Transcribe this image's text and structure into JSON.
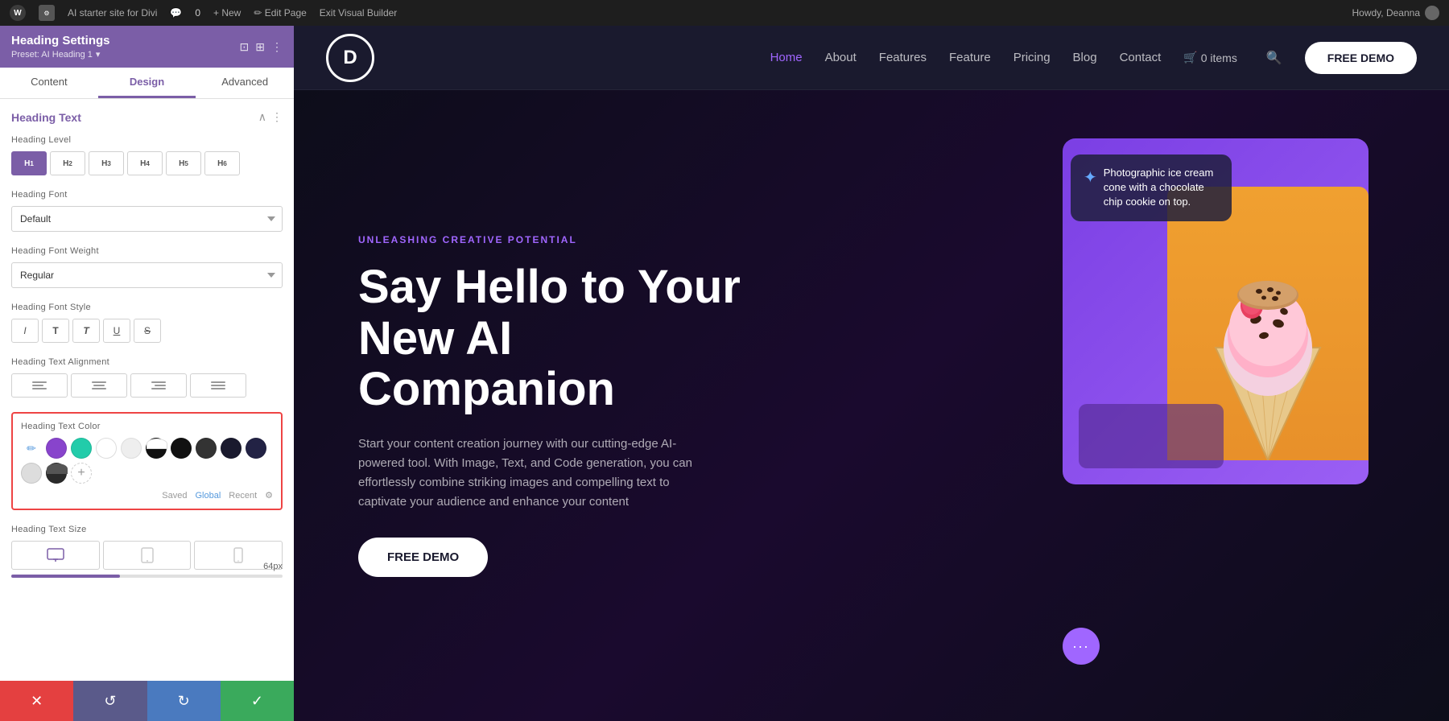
{
  "admin_bar": {
    "site_name": "AI starter site for Divi",
    "comments": "0",
    "new_label": "+ New",
    "edit_page": "✏ Edit Page",
    "exit_builder": "Exit Visual Builder",
    "howdy": "Howdy, Deanna"
  },
  "sidebar": {
    "title": "Heading Settings",
    "preset": "Preset: AI Heading 1",
    "tabs": [
      "Content",
      "Design",
      "Advanced"
    ],
    "active_tab": "Design",
    "section_title": "Heading Text",
    "heading_level": {
      "label": "Heading Level",
      "options": [
        "H1",
        "H2",
        "H3",
        "H4",
        "H5",
        "H6"
      ],
      "active": "H1"
    },
    "heading_font": {
      "label": "Heading Font",
      "value": "Default"
    },
    "heading_font_weight": {
      "label": "Heading Font Weight",
      "value": "Regular"
    },
    "heading_font_style": {
      "label": "Heading Font Style"
    },
    "heading_text_alignment": {
      "label": "Heading Text Alignment"
    },
    "heading_text_color": {
      "label": "Heading Text Color",
      "swatches": [
        {
          "color": "#8844cc",
          "id": "purple"
        },
        {
          "color": "#22ccaa",
          "id": "teal"
        },
        {
          "color": "#ffffff",
          "id": "white1"
        },
        {
          "color": "#eeeeee",
          "id": "lightgray"
        },
        {
          "color": "#222222",
          "id": "darkgray"
        },
        {
          "color": "#111111",
          "id": "black1"
        },
        {
          "color": "#333333",
          "id": "black2"
        },
        {
          "color": "#555555",
          "id": "gray"
        },
        {
          "color": "#1a1a2e",
          "id": "darkblue"
        },
        {
          "color": "#222244",
          "id": "navy"
        },
        {
          "color": "#dddddd",
          "id": "silver"
        },
        {
          "color": "#2a2a2a",
          "id": "charcoal"
        }
      ],
      "color_tabs": [
        "Saved",
        "Global",
        "Recent"
      ],
      "active_color_tab": "Global"
    },
    "heading_text_size": {
      "label": "Heading Text Size",
      "value": "64px"
    },
    "footer": {
      "cancel": "✕",
      "undo": "↺",
      "redo": "↻",
      "save": "✓"
    }
  },
  "site_nav": {
    "logo_text": "D",
    "links": [
      "Home",
      "About",
      "Features",
      "Feature",
      "Pricing",
      "Blog",
      "Contact"
    ],
    "active_link": "Home",
    "cart_label": "0 items",
    "cta_label": "FREE DEMO"
  },
  "hero": {
    "subtitle": "UNLEASHING CREATIVE POTENTIAL",
    "title": "Say Hello to Your New AI Companion",
    "description": "Start your content creation journey with our cutting-edge AI-powered tool. With Image, Text, and Code generation, you can effortlessly combine striking images and compelling text to captivate your audience and enhance your content",
    "cta_label": "FREE DEMO",
    "chat_bubble_text": "Photographic ice cream cone with a chocolate chip cookie on top.",
    "dots_label": "···"
  }
}
